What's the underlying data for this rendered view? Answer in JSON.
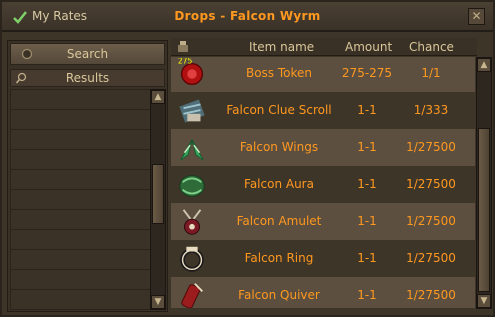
{
  "header": {
    "my_rates_label": "My Rates",
    "title": "Drops - Falcon Wyrm",
    "close_glyph": "✕"
  },
  "left": {
    "search_label": "Search",
    "results_label": "Results",
    "result_rows": 11
  },
  "table": {
    "columns": {
      "name": "Item name",
      "amount": "Amount",
      "chance": "Chance"
    },
    "rows": [
      {
        "name": "Boss Token",
        "amount": "275-275",
        "chance": "1/1",
        "icon": "boss-token-icon",
        "icon_badge": "275"
      },
      {
        "name": "Falcon Clue Scroll",
        "amount": "1-1",
        "chance": "1/333",
        "icon": "clue-scroll-icon"
      },
      {
        "name": "Falcon Wings",
        "amount": "1-1",
        "chance": "1/27500",
        "icon": "wings-icon"
      },
      {
        "name": "Falcon Aura",
        "amount": "1-1",
        "chance": "1/27500",
        "icon": "aura-icon"
      },
      {
        "name": "Falcon Amulet",
        "amount": "1-1",
        "chance": "1/27500",
        "icon": "amulet-icon"
      },
      {
        "name": "Falcon Ring",
        "amount": "1-1",
        "chance": "1/27500",
        "icon": "ring-icon"
      },
      {
        "name": "Falcon Quiver",
        "amount": "1-1",
        "chance": "1/27500",
        "icon": "quiver-icon"
      }
    ]
  },
  "colors": {
    "accent_orange": "#ff981f",
    "text_tan": "#d9c79a",
    "row_light": "#5c4f3f",
    "row_dark": "#3e3529"
  }
}
